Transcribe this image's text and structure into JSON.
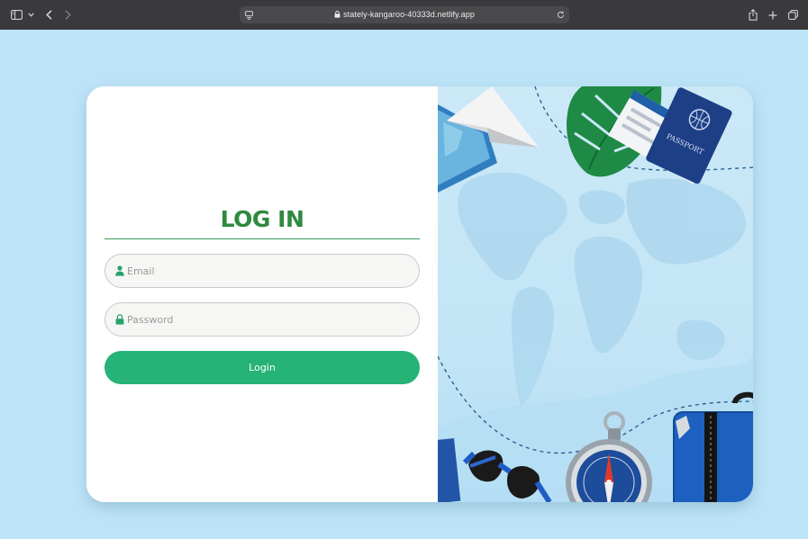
{
  "browser": {
    "url": "stately-kangaroo-40333d.netlify.app",
    "icons": [
      "sidebar-icon",
      "chevron-down-icon",
      "back-icon",
      "forward-icon",
      "site-settings-icon",
      "lock-icon",
      "reload-icon",
      "share-icon",
      "new-tab-icon",
      "tabs-overview-icon"
    ]
  },
  "login": {
    "title": "LOG IN",
    "email_placeholder": "Email",
    "password_placeholder": "Password",
    "button_label": "Login"
  },
  "illustration": {
    "passport_text": "PASSPORT"
  },
  "colors": {
    "page_background": "#bde3f7",
    "accent_green": "#25b377",
    "title_green": "#2d8a3e",
    "toolbar": "#3a3a3c"
  }
}
